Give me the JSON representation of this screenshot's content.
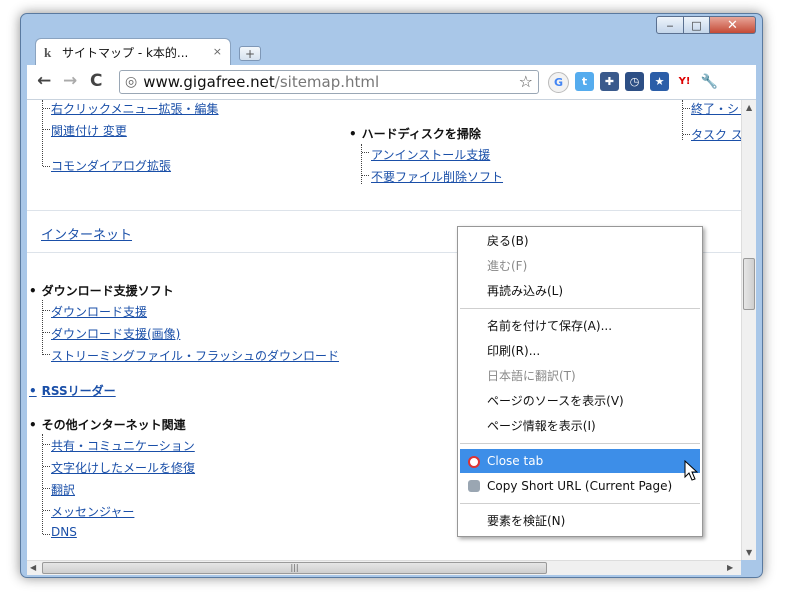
{
  "window": {
    "tab_title": "サイトマップ - k本的...",
    "tab_close": "×",
    "caption_min": "‒",
    "caption_max": "□",
    "caption_close": "✕"
  },
  "toolbar": {
    "url_host": "www.gigafree.net",
    "url_path": "/sitemap.html"
  },
  "content": {
    "top_left_links": [
      "右クリックメニュー拡張・編集",
      "関連付け 変更",
      "コモンダイアログ拡張"
    ],
    "mid_heading": "ハードディスクを掃除",
    "mid_links": [
      "アンインストール支援",
      "不要ファイル削除ソフト"
    ],
    "right_links": [
      "終了・シャ",
      "タスク ス"
    ],
    "section_title": "インターネット",
    "group1_title": "ダウンロード支援ソフト",
    "group1_links": [
      "ダウンロード支援",
      "ダウンロード支援(画像)",
      "ストリーミングファイル・フラッシュのダウンロード"
    ],
    "rss_link": "RSSリーダー",
    "group2_title": "その他インターネット関連",
    "group2_links": [
      "共有・コミュニケーション",
      "文字化けしたメールを修復",
      "翻訳",
      "メッセンジャー",
      "DNS"
    ]
  },
  "context_menu": {
    "items": [
      {
        "label": "戻る(B)",
        "disabled": false
      },
      {
        "label": "進む(F)",
        "disabled": true
      },
      {
        "label": "再読み込み(L)",
        "disabled": false
      },
      {
        "label": "名前を付けて保存(A)...",
        "disabled": false
      },
      {
        "label": "印刷(R)...",
        "disabled": false
      },
      {
        "label": "日本語に翻訳(T)",
        "disabled": true
      },
      {
        "label": "ページのソースを表示(V)",
        "disabled": false
      },
      {
        "label": "ページ情報を表示(I)",
        "disabled": false
      },
      {
        "label": "Close tab",
        "disabled": false,
        "highlighted": true
      },
      {
        "label": "Copy Short URL (Current Page)",
        "disabled": false
      },
      {
        "label": "要素を検証(N)",
        "disabled": false
      }
    ]
  },
  "colors": {
    "link": "#1a4fa8",
    "highlight": "#3d8ee8",
    "frame": "#a9c7e8"
  }
}
